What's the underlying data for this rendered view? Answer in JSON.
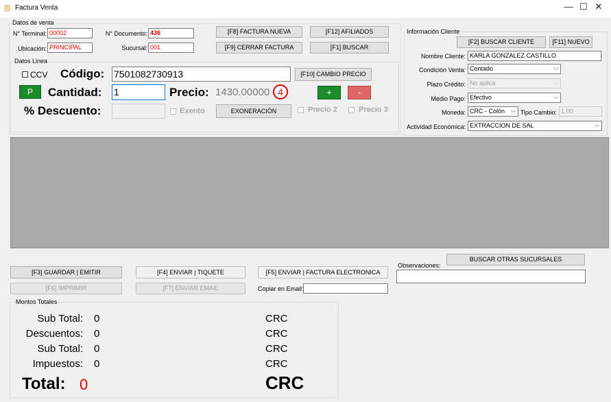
{
  "window": {
    "title": "Factura Venta",
    "minimize": "—",
    "maximize": "☐",
    "close": "✕"
  },
  "datos_venta": {
    "legend": "Datos de venta",
    "terminal_label": "N° Terminal:",
    "terminal_value": "00002",
    "documento_label": "N° Documento:",
    "documento_value": "436",
    "ubicacion_label": "Ubicación:",
    "ubicacion_value": "PRINCIPAL",
    "sucursal_label": "Sucursal:",
    "sucursal_value": "001",
    "btn_factura_nueva": "[F8] FACTURA NUEVA",
    "btn_afiliados": "[F12] AFILIADOS",
    "btn_cerrar_factura": "[F9] CERRAR FACTURA",
    "btn_buscar": "[F1] BUSCAR"
  },
  "datos_linea": {
    "legend": "Datos Linea",
    "ccv_label": "CCV",
    "codigo_label": "Código:",
    "codigo_value": "7501082730913",
    "btn_cambio_precio": "[F10] CAMBIO PRECIO",
    "p_button": "P",
    "cantidad_label": "Cantidad:",
    "cantidad_value": "1",
    "precio_label": "Precio:",
    "precio_value": "1430.00000",
    "precio_badge": "4",
    "plus_button": "+",
    "minus_button": "-",
    "descuento_label": "% Descuento:",
    "descuento_value": "",
    "exento_label": "Exento",
    "btn_exoneracion": "EXONERACIÓN",
    "precio2_label": "Precio 2",
    "precio3_label": "Precio 3"
  },
  "cliente": {
    "legend": "Información Cliente",
    "btn_buscar_cliente": "[F2] BUSCAR CLIENTE",
    "btn_nuevo": "[F11] NUEVO",
    "nombre_label": "Nombre Cliente:",
    "nombre_value": "KARLA GONZALEZ CASTILLO",
    "condicion_label": "Condición Venta:",
    "condicion_value": "Contado",
    "plazo_label": "Plazo Crédito:",
    "plazo_value": "No aplica",
    "medio_label": "Medio Pago:",
    "medio_value": "Efectivo",
    "moneda_label": "Moneda:",
    "moneda_value": "CRC - Colón",
    "tipo_cambio_label": "Tipo Cambio:",
    "tipo_cambio_value": "1.00",
    "actividad_label": "Actividad Económica:",
    "actividad_value": "EXTRACCION DE SAL"
  },
  "acciones": {
    "btn_guardar": "[F3] GUARDAR | EMITIR",
    "btn_enviar_tiquete": "[F4] ENVIAR | TIQUETE",
    "btn_enviar_factura": "[F5] ENVIAR | FACTURA ELECTRONICA",
    "btn_imprimir": "[F6] IMPRIMIR",
    "btn_enviar_email": "[F7] ENVIAR EMAIL",
    "copiar_email_label": "Copiar en Email:",
    "copiar_email_value": "",
    "btn_buscar_sucursales": "BUSCAR OTRAS SUCURSALES",
    "observaciones_label": "Observaciones:",
    "observaciones_value": ""
  },
  "totales": {
    "legend": "Montos Totales",
    "subtotal1_label": "Sub Total:",
    "subtotal1_value": "0",
    "subtotal1_cur": "CRC",
    "descuentos_label": "Descuentos:",
    "descuentos_value": "0",
    "descuentos_cur": "CRC",
    "subtotal2_label": "Sub Total:",
    "subtotal2_value": "0",
    "subtotal2_cur": "CRC",
    "impuestos_label": "Impuestos:",
    "impuestos_value": "0",
    "impuestos_cur": "CRC",
    "total_label": "Total:",
    "total_value": "0",
    "total_cur": "CRC"
  },
  "colors": {
    "accent_red": "#e00000",
    "green_button": "#1a8c2a",
    "minus_button": "#e06666",
    "grid": "#aaaaaa"
  }
}
